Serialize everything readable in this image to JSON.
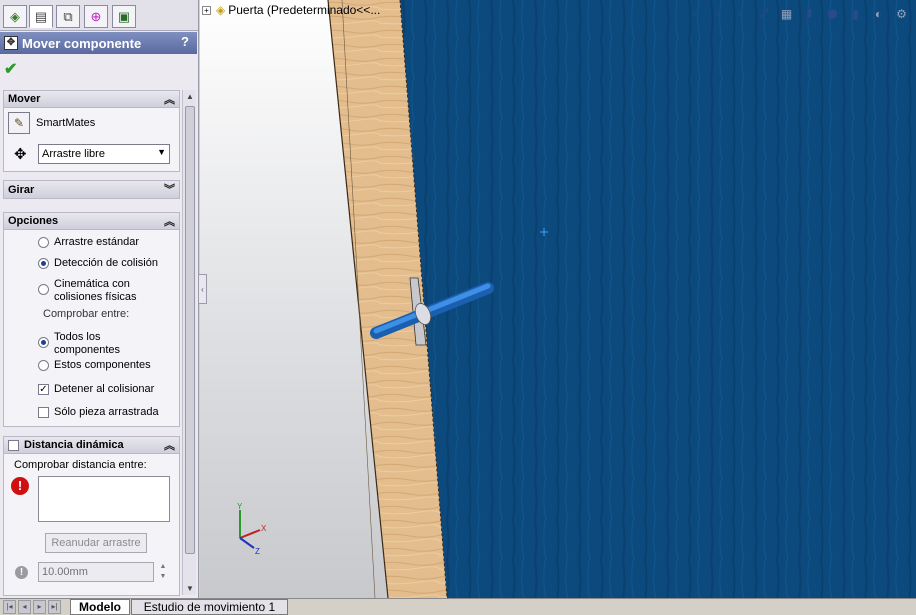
{
  "feature_manager_tabs": [
    {
      "name": "featuremanager-tab",
      "icon": "assembly-tree-icon"
    },
    {
      "name": "propertymanager-tab",
      "icon": "property-sheet-icon"
    },
    {
      "name": "configurationmanager-tab",
      "icon": "configuration-icon"
    },
    {
      "name": "dimxpert-tab",
      "icon": "crosshair-icon"
    },
    {
      "name": "display-manager-tab",
      "icon": "display-icon"
    }
  ],
  "property_manager": {
    "title": "Mover componente",
    "help": "?",
    "mover": {
      "header": "Mover",
      "smartmates_label": "SmartMates",
      "move_type_selected": "Arrastre libre"
    },
    "girar": {
      "header": "Girar"
    },
    "opciones": {
      "header": "Opciones",
      "radio_standard": "Arrastre estándar",
      "radio_collision": "Detección de colisión",
      "radio_physics_line1": "Cinemática con",
      "radio_physics_line2": "colisiones físicas",
      "check_between": "Comprobar entre:",
      "radio_all_line1": "Todos los",
      "radio_all_line2": "componentes",
      "radio_these": "Estos componentes",
      "check_stop": "Detener al colisionar",
      "check_dragged_only": "Sólo pieza arrastrada"
    },
    "distance": {
      "header": "Distancia dinámica",
      "check_between": "Comprobar distancia entre:",
      "resume_button": "Reanudar arrastre",
      "value": "10.00mm"
    }
  },
  "viewport": {
    "tree_node": "Puerta  (Predeterminado<<...",
    "hud_icons": [
      "zoom-to-fit-icon",
      "zoom-to-area-icon",
      "zoom-in-out-icon",
      "section-view-icon",
      "view-orientation-icon",
      "display-style-icon",
      "hide-show-icon",
      "edit-appearance-icon",
      "apply-scene-icon",
      "view-settings-icon"
    ],
    "colors": {
      "panel_dark": "#0b4a7e",
      "wood": "#e0b98a",
      "pin": "#2b7fd9"
    }
  },
  "bottom_tabs": {
    "model": "Modelo",
    "motion_study": "Estudio de movimiento 1"
  }
}
